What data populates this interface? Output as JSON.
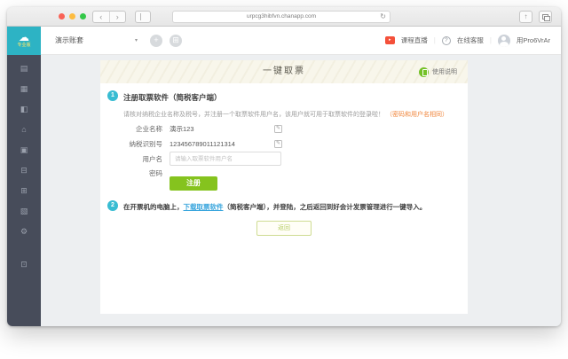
{
  "browser": {
    "url": "urpcg3hibfvn.chanapp.com",
    "back_glyph": "‹",
    "forward_glyph": "›",
    "reload_glyph": "↻",
    "share_glyph": "↑",
    "traffic_colors": {
      "close": "#f96256",
      "minimize": "#fdbc40",
      "zoom": "#33c748"
    }
  },
  "app_header": {
    "logo_cloud_glyph": "☁",
    "logo_edition": "专业版",
    "account_set": "演示账套",
    "caret_glyph": "▾",
    "new_glyph": "+",
    "apps_glyph": "⊞",
    "live_play_glyph": "▸",
    "live_label": "课程直播",
    "help_glyph": "?",
    "support_label": "在线客服",
    "username": "用Pro6VrAr",
    "separator": "|"
  },
  "sidebar": {
    "icons": [
      {
        "name": "voucher-icon",
        "glyph": "▤"
      },
      {
        "name": "journal-icon",
        "glyph": "▦"
      },
      {
        "name": "report-icon",
        "glyph": "◧"
      },
      {
        "name": "funds-icon",
        "glyph": "⌂"
      },
      {
        "name": "invoice-icon",
        "glyph": "▣"
      },
      {
        "name": "salary-icon",
        "glyph": "⊟"
      },
      {
        "name": "assets-icon",
        "glyph": "⊞"
      },
      {
        "name": "checkout-icon",
        "glyph": "▧"
      },
      {
        "name": "settings-icon",
        "glyph": "⚙"
      },
      {
        "name": "gift-icon",
        "glyph": "⊡"
      }
    ]
  },
  "page": {
    "title": "一键取票",
    "help_label": "使用说明",
    "step1": {
      "number": "1",
      "title": "注册取票软件（简税客户端）",
      "note": "请核对纳税企业名称及税号，并注册一个取票软件用户名，该用户就可用于取票软件的登录啦！",
      "note_highlight": "（密码和用户名相同）",
      "fields": [
        {
          "label": "企业名称",
          "value": "演示123"
        },
        {
          "label": "纳税识别号",
          "value": "123456789011121314"
        },
        {
          "label": "用户名",
          "placeholder": "请输入取票软件用户名"
        },
        {
          "label": "密码",
          "value": ""
        }
      ],
      "edit_glyph": "✎",
      "register_button": "注册"
    },
    "step2": {
      "number": "2",
      "text_before": "在开票机的电脑上，",
      "link": "下载取票软件",
      "text_after": "（简税客户端），并登陆，之后返回到好会计发票管理进行一键导入。",
      "back_button": "返回"
    }
  },
  "colors": {
    "brand_teal": "#2db3c4",
    "sidebar_bg": "#474c5a",
    "step_cyan": "#38bcd2",
    "register_green": "#85c31e",
    "help_green": "#74c127",
    "link_blue": "#38a5dd",
    "note_orange": "#f0863c",
    "live_red": "#f4503a"
  }
}
